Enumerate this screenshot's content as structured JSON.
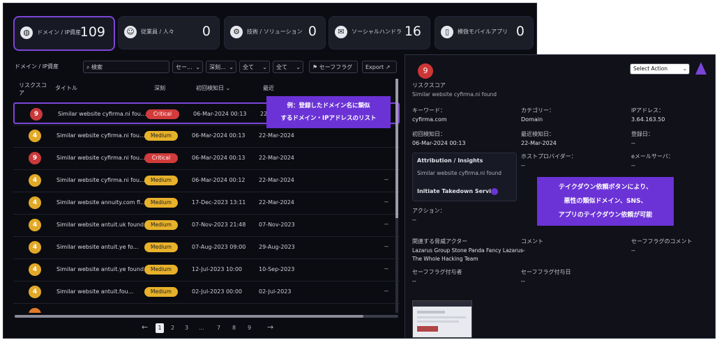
{
  "summary_cards": [
    {
      "icon": "globe-icon",
      "label": "ドメイン / IP資産",
      "value": "109"
    },
    {
      "icon": "person-icon",
      "label": "従業員 / 人々",
      "value": "0"
    },
    {
      "icon": "gear-icon",
      "label": "技術 / ソリューション",
      "value": "0"
    },
    {
      "icon": "chat-icon",
      "label": "ソーシャルハンドラ",
      "value": "16"
    },
    {
      "icon": "mobile-icon",
      "label": "模倣モバイルアプリ",
      "value": "0"
    }
  ],
  "toolbar": {
    "section_title": "ドメイン / IP資産",
    "search_placeholder": "検索",
    "filter1": "セー...",
    "filter2": "深刻...",
    "filter3": "全て",
    "filter4": "全て",
    "safe_flag": "セーフフラグ",
    "export": "Export"
  },
  "table": {
    "headers": [
      "リスクスコア",
      "タイトル",
      "深刻",
      "初回検知日",
      "最近"
    ],
    "rows": [
      {
        "score": "9",
        "color": "red",
        "title": "Similar website cyfirma.ni fou...",
        "severity": "Critical",
        "first": "06-Mar-2024 00:13",
        "last": "22-Mar-2024",
        "dash": ""
      },
      {
        "score": "4",
        "color": "amber",
        "title": "Similar website cyfirma.ni fou...",
        "severity": "Medium",
        "first": "06-Mar-2024 00:13",
        "last": "22-Mar-2024",
        "dash": ""
      },
      {
        "score": "9",
        "color": "red",
        "title": "Similar website cyfirma.ni fou...",
        "severity": "Critical",
        "first": "06-Mar-2024 00:13",
        "last": "22-Mar-2024",
        "dash": ""
      },
      {
        "score": "4",
        "color": "amber",
        "title": "Similar website cyfirma.ni fou...",
        "severity": "Medium",
        "first": "06-Mar-2024 00:12",
        "last": "22-Mar-2024",
        "dash": "--"
      },
      {
        "score": "4",
        "color": "amber",
        "title": "Similar website annuity.com fl...",
        "severity": "Medium",
        "first": "17-Dec-2023 13:11",
        "last": "22-Mar-2024",
        "dash": "--"
      },
      {
        "score": "4",
        "color": "amber",
        "title": "Similar website antuit.uk found",
        "severity": "Medium",
        "first": "07-Nov-2023 21:48",
        "last": "07-Nov-2023",
        "dash": "--"
      },
      {
        "score": "4",
        "color": "amber",
        "title": "Similar website antuit.ye fo...",
        "severity": "Medium",
        "first": "07-Aug-2023 09:00",
        "last": "29-Aug-2023",
        "dash": "--"
      },
      {
        "score": "4",
        "color": "amber",
        "title": "Similar website antuit.ye found",
        "severity": "Medium",
        "first": "12-Jul-2023 10:00",
        "last": "10-Sep-2023",
        "dash": "--"
      },
      {
        "score": "4",
        "color": "amber",
        "title": "Similar website antuit.fou...",
        "severity": "Medium",
        "first": "02-Jul-2023 00:00",
        "last": "02-Jul-2023",
        "dash": "--"
      }
    ]
  },
  "pagination": {
    "prev": "←",
    "pages": [
      "1",
      "2",
      "3",
      "...",
      "7",
      "8",
      "9"
    ],
    "next": "→"
  },
  "callout_left": {
    "line1": "例：登録したドメイン名に類似",
    "line2": "するドメイン・IPアドレスのリスト"
  },
  "detail": {
    "score": "9",
    "score_label": "リスクスコア",
    "subtitle": "Similar website cyfirma.ni found",
    "select_action": "Select Action",
    "keyword_label": "キーワード：",
    "keyword": "cyfirma.com",
    "category_label": "カテゴリー：",
    "category": "Domain",
    "ip_label": "IPアドレス：",
    "ip": "3.64.163.50",
    "first_label": "初回検知日：",
    "first": "06-Mar-2024 00:13",
    "last_label": "最近検知日：",
    "last": "22-Mar-2024",
    "registered_label": "登録日：",
    "registered": "--",
    "attribution_title": "Attribution / Insights",
    "attribution_text": "Similar website cyfirma.ni found",
    "takedown": "Initiate Takedown Service",
    "host_label": "ホストプロバイダー：",
    "host": "--",
    "mail_label": "eメールサーバ：",
    "mail": "--",
    "action_label": "アクション：",
    "action": "--",
    "actor_label": "関連する脅威アクター",
    "actor_line1": "Lazarus Group Stone Panda Fancy Lazarus",
    "actor_line2": "The Whole Hacking Team",
    "comment_label": "コメント",
    "comment": "--",
    "safeflag_comment_label": "セーフフラグのコメント",
    "safeflag_comment": "--",
    "safeflag_by_label": "セーフフラグ付与者",
    "safeflag_by": "--",
    "safeflag_date_label": "セーフフラグ付与日",
    "safeflag_date": "--"
  },
  "callout_right": {
    "line1": "テイクダウン依頼ボタンにより、",
    "line2": "悪性の類似ドメイン、SNS、",
    "line3": "アプリのテイクダウン依頼が可能"
  }
}
